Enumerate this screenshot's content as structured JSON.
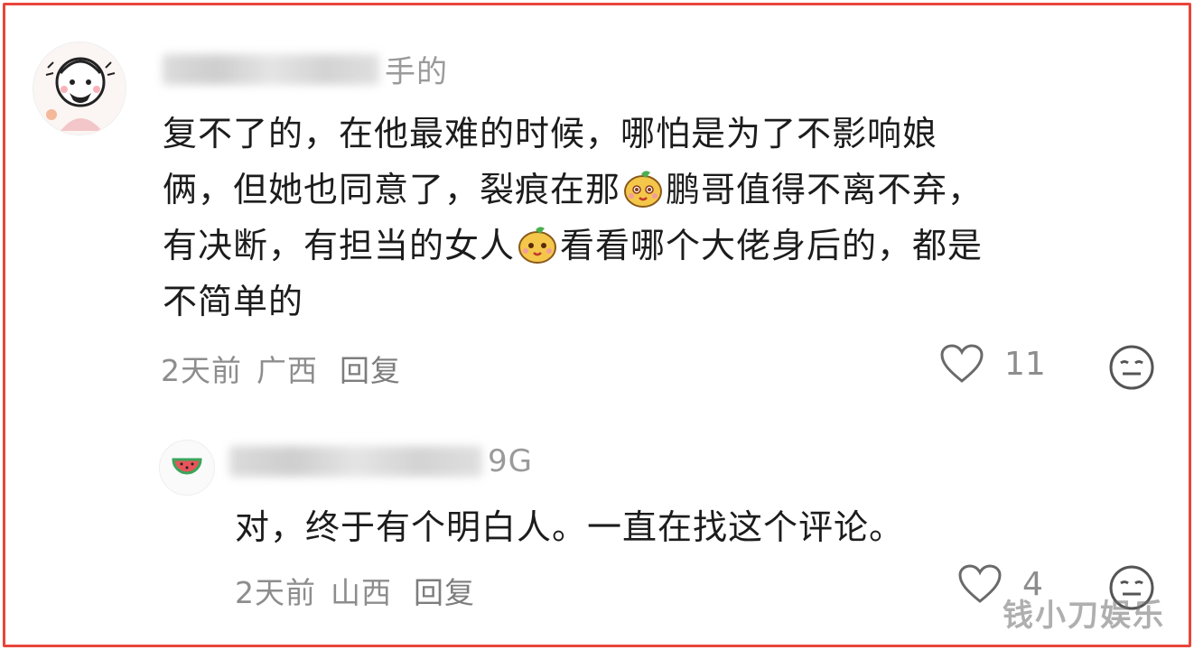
{
  "comment": {
    "username_visible": "手的",
    "lines": [
      "复不了的，在他最难的时候，哪怕是为了不影响娘",
      "俩，但她也同意了，裂痕在那",
      "鹏哥值得不离不弃，",
      "有决断，有担当的女人",
      "看看哪个大佬身后的，都是",
      "不简单的"
    ],
    "time": "2天前",
    "location": "广西",
    "reply_label": "回复",
    "like_count": "11"
  },
  "reply": {
    "username_visible": "9G",
    "text": "对，终于有个明白人。一直在找这个评论。",
    "time": "2天前",
    "location": "山西",
    "reply_label": "回复",
    "like_count": "4"
  },
  "watermark": "钱小刀娱乐",
  "colors": {
    "border": "#e8453c",
    "meta": "#8d8d8d",
    "text": "#1c1c1c"
  },
  "icons": [
    "user-avatar-icon",
    "watermelon-avatar-icon",
    "heart-icon",
    "neutral-face-icon",
    "mango-emoji-icon"
  ]
}
